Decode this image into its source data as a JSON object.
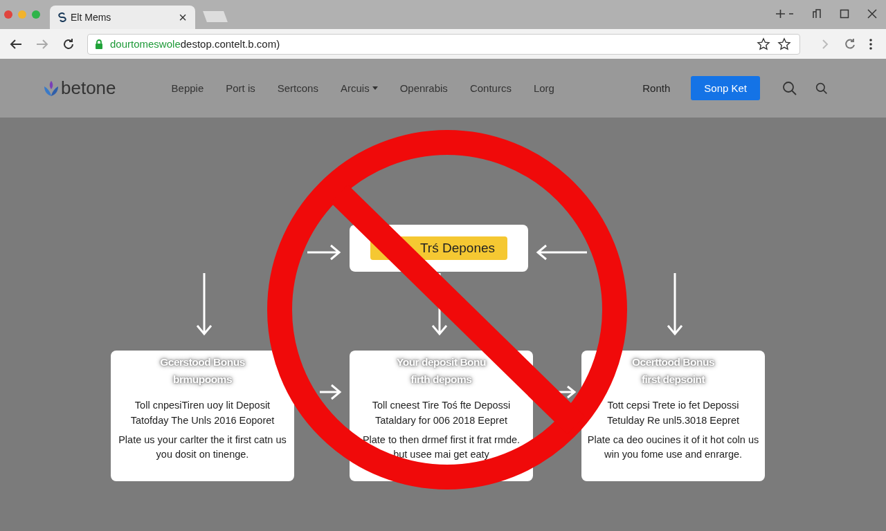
{
  "browser": {
    "tab": {
      "title": "Elt Mems",
      "close": "×"
    },
    "url_secure": "dourtomeswole",
    "url_rest": "destop.contelt.b.com)"
  },
  "site": {
    "logo": "betone",
    "nav": [
      {
        "label": "Beppie",
        "dropdown": false
      },
      {
        "label": "Port is",
        "dropdown": false
      },
      {
        "label": "Sertcons",
        "dropdown": false
      },
      {
        "label": "Arcuis",
        "dropdown": true
      },
      {
        "label": "Openrabis",
        "dropdown": false
      },
      {
        "label": "Conturcs",
        "dropdown": false
      },
      {
        "label": "Lorg",
        "dropdown": false
      }
    ],
    "signin": "Ronth",
    "cta": "Sonp Ket"
  },
  "diagram": {
    "top": "Trś Depones",
    "cards": [
      {
        "title": [
          "Gcerstood Bonus",
          "brmupooms"
        ],
        "lines": [
          "Toll cnpesiTiren uoy lit Deposit",
          "Tatofday The Unls 2016 Eoporet"
        ],
        "text": "Plate us your carlter the it first catn us you dosit on tinenge."
      },
      {
        "title": [
          "Your deposit Bonu",
          "firth depoms"
        ],
        "lines": [
          "Toll cneest Tire Toś fte Depossi",
          "Tataldary for 006 2018 Eepret"
        ],
        "text": "Plate to then drmef first it frat rmde. but usee mai get eaty"
      },
      {
        "title": [
          "Ocerttood Bonus",
          "first depsoint"
        ],
        "lines": [
          "Tott cepsi Trete io fet Depossi",
          "Tetulday Re unl5.3018 Eepret"
        ],
        "text": "Plate ca deo oucines it of it hot coln us win you fome use and enrarge."
      }
    ]
  }
}
